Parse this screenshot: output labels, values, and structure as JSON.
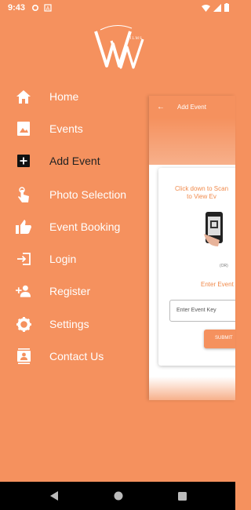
{
  "status": {
    "time": "9:43"
  },
  "drawer": {
    "items": [
      {
        "label": "Home",
        "icon": "home-icon"
      },
      {
        "label": "Events",
        "icon": "image-icon"
      },
      {
        "label": "Add Event",
        "icon": "add-box-icon",
        "active": true
      },
      {
        "label": "Photo Selection",
        "icon": "touch-icon"
      },
      {
        "label": "Event Booking",
        "icon": "thumbs-up-icon"
      },
      {
        "label": "Login",
        "icon": "login-icon"
      },
      {
        "label": "Register",
        "icon": "person-add-icon"
      },
      {
        "label": "Settings",
        "icon": "gear-icon"
      },
      {
        "label": "Contact Us",
        "icon": "contacts-icon"
      }
    ]
  },
  "preview": {
    "title": "Add Event",
    "scan_hint": "Click down to Scan\nto View Ev",
    "or": "(OR)",
    "enter_label": "Enter Event",
    "key_placeholder": "Enter Event Key",
    "submit": "SUBMIT"
  },
  "colors": {
    "accent": "#F5915E",
    "accent_text": "#F08A4B"
  }
}
